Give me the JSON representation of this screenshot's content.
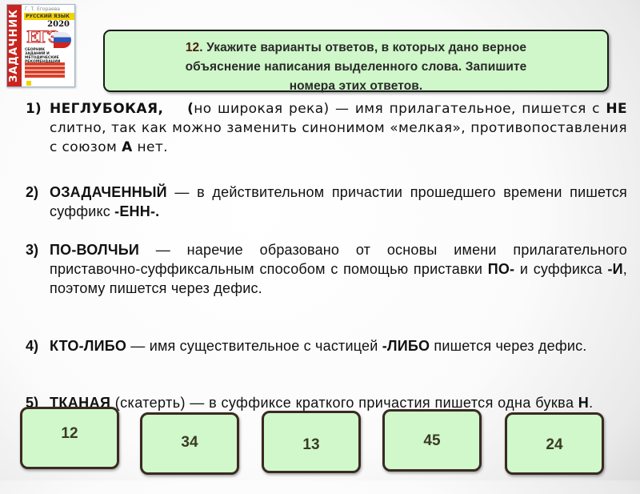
{
  "cover": {
    "spine_text": "ЗАДАЧНИК",
    "author": "Г. Т. Егораева",
    "subject": "РУССКИЙ ЯЗЫК",
    "year": "2020",
    "exam": "ЕГЭ",
    "description": "СБОРНИК ЗАДАНИЙ И МЕТОДИЧЕСКИЕ РЕКОМЕНДАЦИИ"
  },
  "task": {
    "number": "12",
    "text_line1": ". Укажите варианты ответов, в которых дано верное",
    "text_line2": "объяснение написания выделенного слова. Запишите",
    "text_line3": "номера этих ответов."
  },
  "items": [
    {
      "marker": "1)",
      "word": "НЕГЛУБОКАЯ,",
      "parts": [
        "(",
        "но широкая река) — имя прилагательное, пишется с ",
        "НЕ",
        " слитно, так как можно заменить синонимом «мелкая», противопоставления с союзом ",
        "А",
        " нет."
      ]
    },
    {
      "marker": "2)",
      "word": "ОЗАДАЧЕННЫЙ",
      "parts": [
        " — в действительном причастии прошедшего времени пишется суффикс ",
        "-ЕНН-."
      ]
    },
    {
      "marker": "3)",
      "word": "ПО-ВОЛЧЬИ",
      "parts": [
        " — наречие образовано от основы имени прилагательного приставочно-суффиксальным способом с помощью приставки ",
        "ПО-",
        " и суффикса ",
        "-И",
        ", поэтому пишется через дефис."
      ]
    },
    {
      "marker": "4)",
      "word": "КТО-ЛИБО",
      "parts": [
        " — имя существительное с частицей ",
        "-ЛИБО",
        " пишется через дефис."
      ]
    },
    {
      "marker": "5)",
      "word": "ТКАНАЯ",
      "parts": [
        " (скатерть) — в суффиксе краткого причастия пишется одна буква ",
        "Н",
        "."
      ]
    }
  ],
  "answers": [
    "12",
    "34",
    "13",
    "45",
    "24"
  ],
  "colors": {
    "box_fill": "#cff7c9",
    "box_border": "#1a1a1a",
    "answer_border": "#3a2a22",
    "task_number": "#4a1b10"
  }
}
